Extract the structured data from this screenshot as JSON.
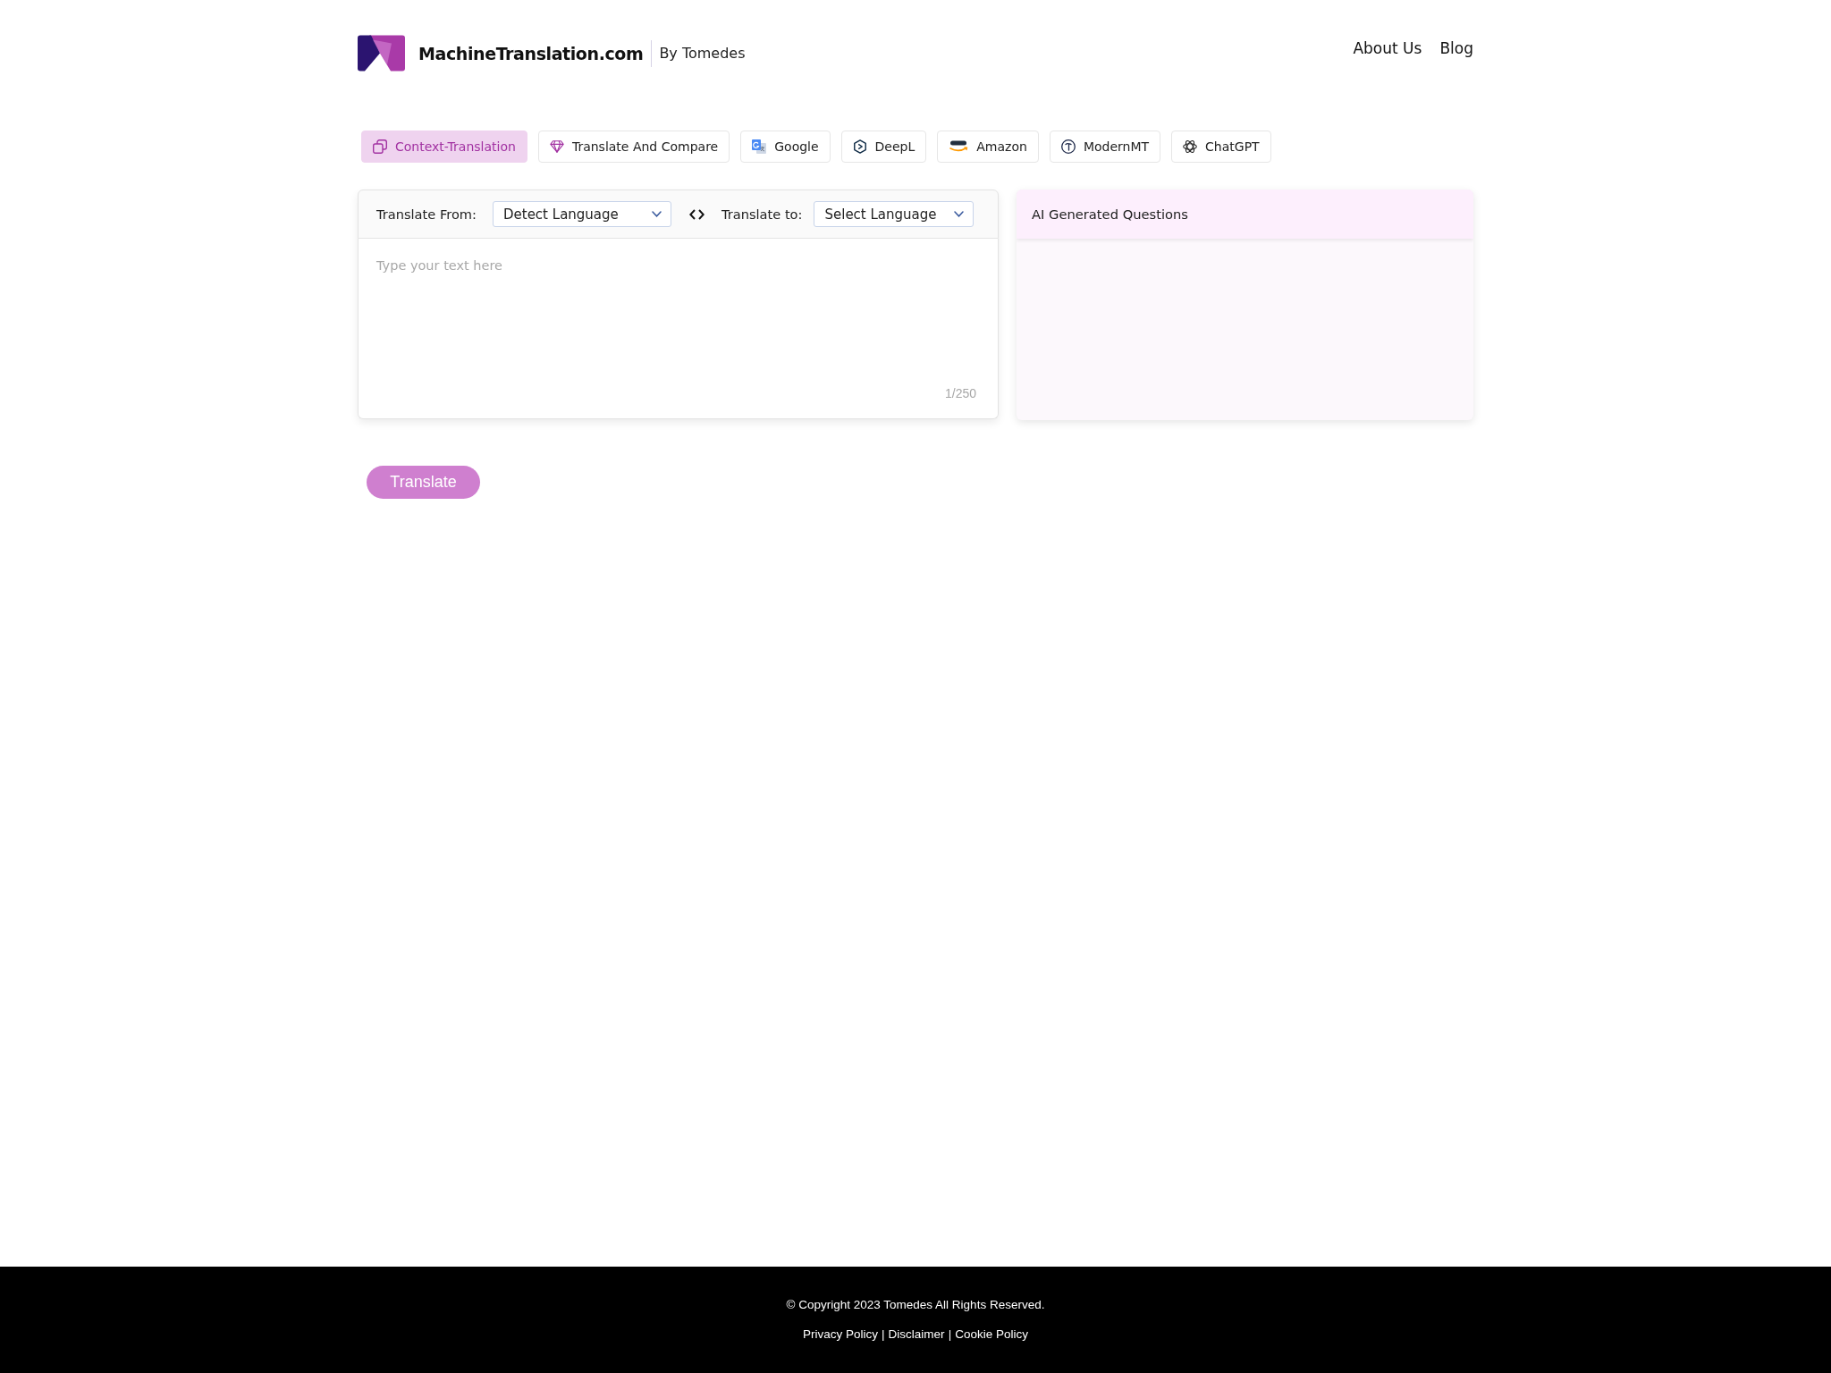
{
  "header": {
    "site_title": "MachineTranslation.com",
    "byline": "By Tomedes",
    "nav": [
      "About Us",
      "Blog"
    ]
  },
  "engine_tabs": [
    {
      "label": "Context-Translation",
      "kind": "context",
      "selected": true
    },
    {
      "label": "Translate And Compare",
      "kind": "compare",
      "selected": false
    },
    {
      "label": "Google",
      "kind": "google",
      "selected": false
    },
    {
      "label": "DeepL",
      "kind": "deepl",
      "selected": false
    },
    {
      "label": "Amazon",
      "kind": "amazon",
      "selected": false
    },
    {
      "label": "ModernMT",
      "kind": "modernmt",
      "selected": false
    },
    {
      "label": "ChatGPT",
      "kind": "chatgpt",
      "selected": false
    }
  ],
  "translator": {
    "from_label": "Translate From:",
    "from_value": "Detect Language",
    "to_label": "Translate to:",
    "to_value": "Select Language",
    "input": {
      "placeholder": "Type your text here"
    },
    "counter": "1/250"
  },
  "questions_panel": {
    "title": "AI Generated Questions"
  },
  "translate_button": "Translate",
  "footer": {
    "copyright": "© Copyright 2023 Tomedes All Rights Reserved.",
    "links": [
      "Privacy Policy",
      "Disclaimer",
      "Cookie Policy"
    ],
    "link_separator": "|"
  }
}
